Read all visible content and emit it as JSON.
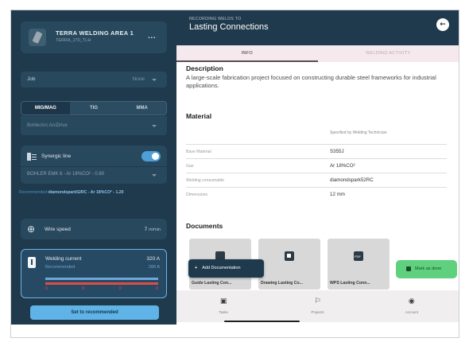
{
  "machine": {
    "name": "TERRA WELDING AREA 1",
    "sub": "TERRA_270_TLH",
    "more": "..."
  },
  "job": {
    "label": "Job",
    "value": "None"
  },
  "process_tabs": [
    {
      "label": "MIG/MAG",
      "active": true
    },
    {
      "label": "TIG",
      "active": false
    },
    {
      "label": "MMA",
      "active": false
    }
  ],
  "wire": {
    "value": "BohlerArc ArcDrive"
  },
  "synergic": {
    "label": "Synergic line",
    "enabled": true,
    "line": "BOHLER EMK 6 - Ar 18%CO² - 0.80"
  },
  "recommended": {
    "prefix": "Recommended:",
    "value": "diamondspark52RC - Ar 18%CO² - 1.20"
  },
  "wire_speed": {
    "label": "Wire speed",
    "value": "7",
    "unit": "m/min"
  },
  "welding_current": {
    "label": "Welding current",
    "value": "320",
    "unit": "A",
    "recommended_label": "Recommended",
    "recommended_value": "280",
    "recommended_unit": "A",
    "ticks": [
      "0",
      "0",
      "0",
      "0"
    ]
  },
  "set_button": "Set to recommended",
  "header": {
    "kicker": "RECORDING WELDS TO",
    "title": "Lasting Connections",
    "back_icon": "arrow-left-icon"
  },
  "tabs": [
    {
      "label": "INFO",
      "active": true
    },
    {
      "label": "WELDING ACTIVITY",
      "active": false
    }
  ],
  "description": {
    "heading": "Description",
    "text": "A large-scale fabrication project focused on constructing durable steel frameworks for industrial applications."
  },
  "material": {
    "heading": "Material",
    "specified_by": "Specified by Welding Technician",
    "rows": [
      {
        "key": "Base Material",
        "value": "S355J"
      },
      {
        "key": "Gas",
        "value": "Ar 18%CO²"
      },
      {
        "key": "Welding consumable",
        "value": "diamondspark52RC"
      },
      {
        "key": "Dimensions",
        "value": "12 mm"
      }
    ]
  },
  "documents": {
    "heading": "Documents",
    "items": [
      {
        "name": "Guide Lasting Con...",
        "icon": "document-icon"
      },
      {
        "name": "Drawing Lasting Co...",
        "icon": "image-icon"
      },
      {
        "name": "WPS Lasting Conn...",
        "icon": "pdf-icon",
        "badge": "PDF"
      }
    ],
    "add_label": "Add Documentation",
    "add_icon": "plus-icon"
  },
  "mark_done": {
    "label": "Mark as done"
  },
  "bottom_nav": [
    {
      "label": "Tasks",
      "icon": "clipboard-icon"
    },
    {
      "label": "Projects",
      "icon": "flag-icon"
    },
    {
      "label": "Account",
      "icon": "account-icon"
    }
  ],
  "colors": {
    "panel": "#1f3a4d",
    "accent": "#5fb3e6",
    "success": "#5fd17e",
    "alert": "#e04b48",
    "tabbar": "#f6e9ee"
  }
}
